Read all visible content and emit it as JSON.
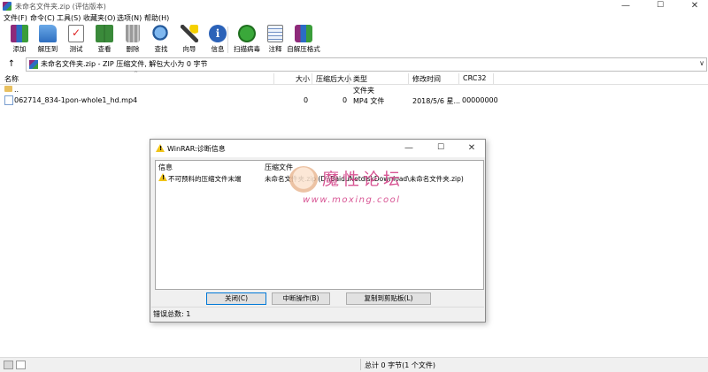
{
  "window": {
    "title": "未命名文件夹.zip (评估版本)"
  },
  "window_controls": {
    "minimize": "—",
    "maximize": "☐",
    "close": "✕"
  },
  "menu": [
    "文件(F)",
    "命令(C)",
    "工具(S)",
    "收藏夹(O)",
    "选项(N)",
    "帮助(H)"
  ],
  "toolbar": [
    {
      "label": "添加",
      "icon": "add-archive-icon"
    },
    {
      "label": "解压到",
      "icon": "extract-to-icon"
    },
    {
      "label": "测试",
      "icon": "test-icon"
    },
    {
      "label": "查看",
      "icon": "view-book-icon"
    },
    {
      "label": "删除",
      "icon": "trash-icon"
    },
    {
      "label": "查找",
      "icon": "magnifier-icon"
    },
    {
      "label": "向导",
      "icon": "wizard-wand-icon"
    },
    {
      "label": "信息",
      "icon": "info-icon"
    },
    {
      "label": "扫描病毒",
      "icon": "virus-scan-icon"
    },
    {
      "label": "注释",
      "icon": "comment-icon"
    },
    {
      "label": "自解压格式",
      "icon": "sfx-icon"
    }
  ],
  "address": {
    "up": "↑",
    "text": "未命名文件夹.zip - ZIP 压缩文件, 解包大小为 0 字节",
    "dropdown": "∨"
  },
  "columns": [
    "名称",
    "大小",
    "压缩后大小",
    "类型",
    "修改时间",
    "CRC32"
  ],
  "rows": [
    {
      "name": "..",
      "size": "",
      "packed": "",
      "type": "文件夹",
      "modified": "",
      "crc": ""
    },
    {
      "name": "062714_834-1pon-whole1_hd.mp4",
      "size": "0",
      "packed": "0",
      "type": "MP4 文件",
      "modified": "2018/5/6 星...",
      "crc": "00000000"
    }
  ],
  "dialog": {
    "title": "WinRAR:诊断信息",
    "controls": {
      "minimize": "—",
      "maximize": "☐",
      "close": "✕"
    },
    "headers": {
      "info": "信息",
      "archive": "压缩文件"
    },
    "messages": [
      {
        "info": "不可预料的压缩文件末端",
        "archive": "未命名文件夹.zip (D:\\BaiduNetdiskDownload\\未命名文件夹.zip)"
      }
    ],
    "watermark": {
      "title": "魔性论坛",
      "url": "www.moxing.cool"
    },
    "buttons": {
      "close": "关闭(C)",
      "break": "中断操作(B)",
      "copy": "复制到剪贴板(L)"
    },
    "error_count": "错误总数: 1"
  },
  "status": {
    "total": "总计 0 字节(1 个文件)"
  },
  "colors": {
    "accent": "#0078d7",
    "warning": "#f0c419",
    "watermark": "#d4458a"
  }
}
